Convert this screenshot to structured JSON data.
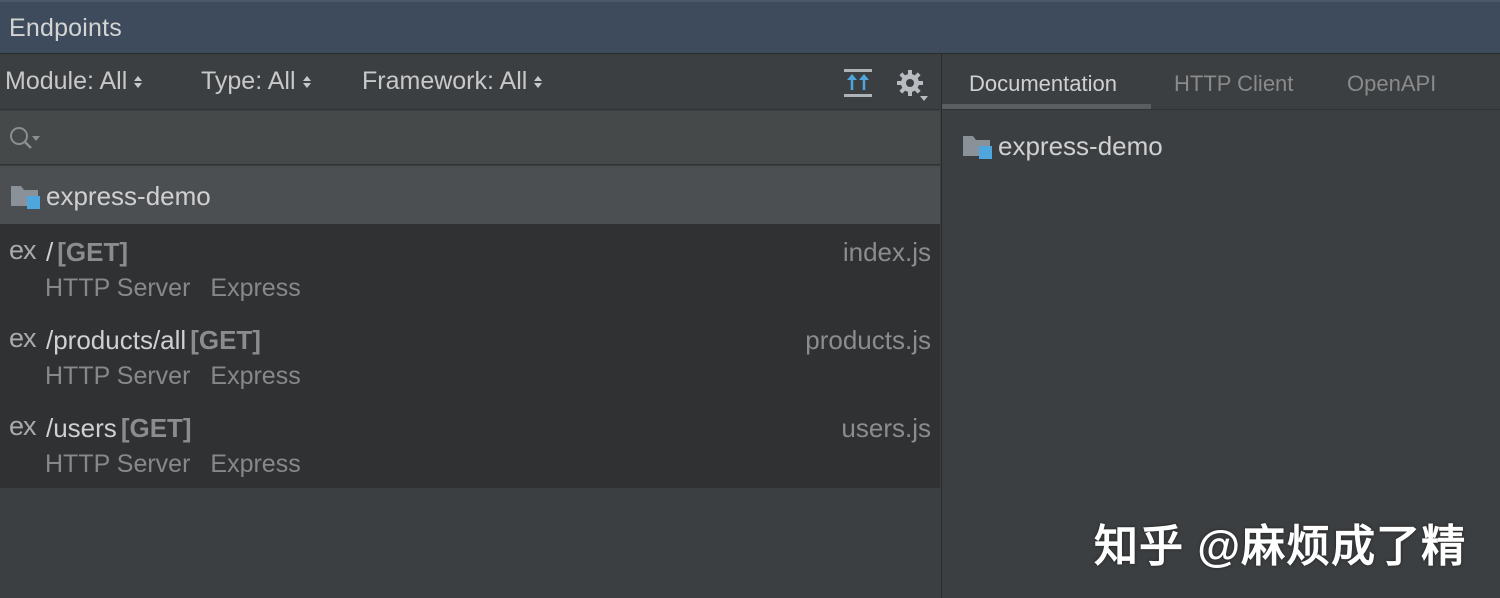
{
  "window": {
    "title": "Endpoints"
  },
  "filters": [
    {
      "label": "Module: All"
    },
    {
      "label": "Type: All"
    },
    {
      "label": "Framework: All"
    }
  ],
  "toolbar": {
    "icons": [
      "expand-all-icon",
      "gear-icon"
    ]
  },
  "search": {
    "value": "",
    "placeholder": ""
  },
  "group": {
    "name": "express-demo",
    "icon": "module-folder-icon"
  },
  "endpoints": [
    {
      "badge": "ex",
      "path": "/",
      "method": "[GET]",
      "file": "index.js",
      "type": "HTTP Server",
      "framework": "Express"
    },
    {
      "badge": "ex",
      "path": "/products/all",
      "method": "[GET]",
      "file": "products.js",
      "type": "HTTP Server",
      "framework": "Express"
    },
    {
      "badge": "ex",
      "path": "/users",
      "method": "[GET]",
      "file": "users.js",
      "type": "HTTP Server",
      "framework": "Express"
    }
  ],
  "tabs": [
    {
      "label": "Documentation",
      "active": true
    },
    {
      "label": "HTTP Client",
      "active": false
    },
    {
      "label": "OpenAPI",
      "active": false
    }
  ],
  "documentation": {
    "title": "express-demo"
  },
  "watermark": "知乎 @麻烦成了精",
  "colors": {
    "accent": "#4ea6dc",
    "folder": "#8a9199",
    "title_bar": "#3d4b5c"
  }
}
